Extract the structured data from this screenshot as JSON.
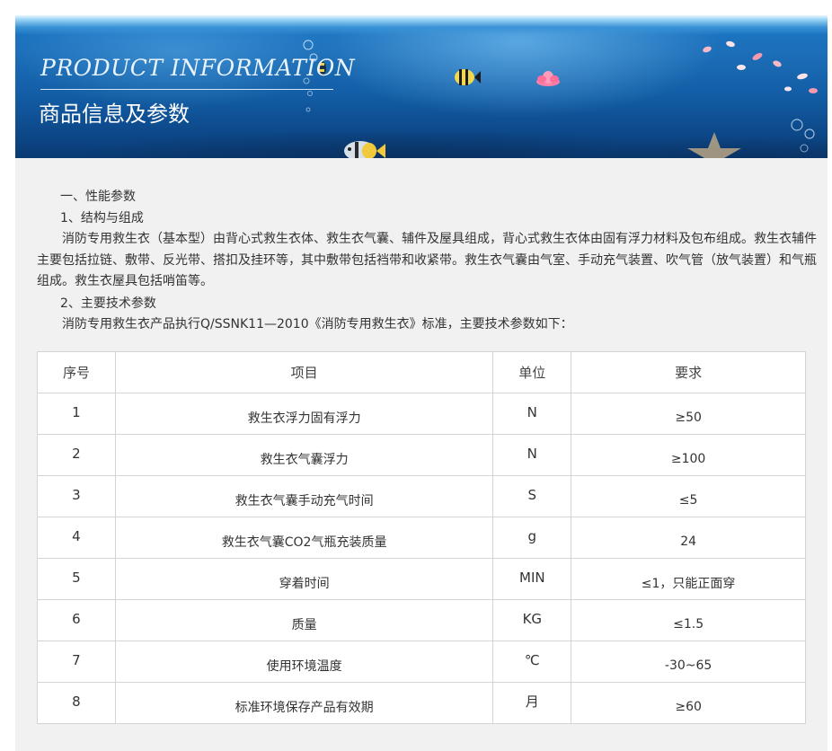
{
  "banner": {
    "title_en": "PRODUCT INFORMATION",
    "title_cn": "商品信息及参数"
  },
  "content": {
    "section1_heading": "一、性能参数",
    "subsection1_heading": "1、结构与组成",
    "paragraph1": "消防专用救生衣（基本型）由背心式救生衣体、救生衣气囊、辅件及屋具组成，背心式救生衣体由固有浮力材料及包布组成。救生衣辅件主要包括拉链、敷带、反光带、搭扣及挂环等，其中敷带包括裆带和收紧带。救生衣气囊由气室、手动充气装置、吹气管（放气装置）和气瓶组成。救生衣屋具包括哨笛等。",
    "subsection2_heading": "2、主要技术参数",
    "paragraph2": "消防专用救生衣产品执行Q/SSNK11—2010《消防专用救生衣》标准，主要技术参数如下："
  },
  "table": {
    "headers": [
      "序号",
      "项目",
      "单位",
      "要求"
    ],
    "rows": [
      {
        "no": "1",
        "item": "救生衣浮力固有浮力",
        "unit": "N",
        "req": "≥50"
      },
      {
        "no": "2",
        "item": "救生衣气囊浮力",
        "unit": "N",
        "req": "≥100"
      },
      {
        "no": "3",
        "item": "救生衣气囊手动充气时间",
        "unit": "S",
        "req": "≤5"
      },
      {
        "no": "4",
        "item": "救生衣气囊CO2气瓶充装质量",
        "unit": "g",
        "req": "24"
      },
      {
        "no": "5",
        "item": "穿着时间",
        "unit": "MIN",
        "req": "≤1，只能正面穿"
      },
      {
        "no": "6",
        "item": "质量",
        "unit": "KG",
        "req": "≤1.5"
      },
      {
        "no": "7",
        "item": "使用环境温度",
        "unit": "℃",
        "req": "-30~65"
      },
      {
        "no": "8",
        "item": "标准环境保存产品有效期",
        "unit": "月",
        "req": "≥60"
      }
    ]
  }
}
